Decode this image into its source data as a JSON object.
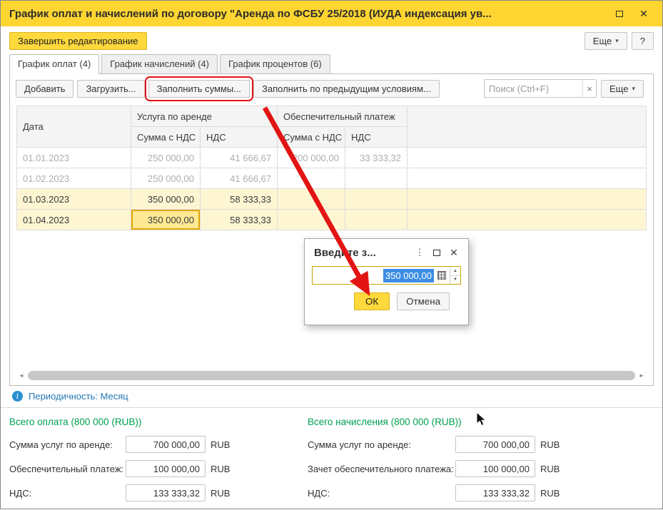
{
  "window": {
    "title": "График оплат и начислений по договору \"Аренда по ФСБУ 25/2018 (ИУДА индексация ув..."
  },
  "icons": {
    "dropdown": "▾",
    "close": "✕",
    "clear": "×",
    "dots": "⋮",
    "info": "i",
    "spin_up": "▲",
    "spin_down": "▼",
    "scroll_left": "◄",
    "scroll_right": "►"
  },
  "actions": {
    "finish": "Завершить редактирование",
    "more": "Еще",
    "help": "?"
  },
  "tabs": [
    {
      "label": "График оплат (4)"
    },
    {
      "label": "График начислений (4)"
    },
    {
      "label": "График процентов (6)"
    }
  ],
  "toolbar": {
    "add": "Добавить",
    "load": "Загрузить...",
    "fill_sums": "Заполнить суммы...",
    "fill_prev": "Заполнить по предыдущим условиям...",
    "search_placeholder": "Поиск (Ctrl+F)",
    "more": "Еще"
  },
  "table": {
    "col_date": "Дата",
    "col_service": "Услуга по аренде",
    "col_deposit": "Обеспечительный платеж",
    "col_sum_vat": "Сумма с НДС",
    "col_vat": "НДС",
    "rows": [
      {
        "date": "01.01.2023",
        "service_sum": "250 000,00",
        "service_vat": "41 666,67",
        "deposit_sum": "200 000,00",
        "deposit_vat": "33 333,32"
      },
      {
        "date": "01.02.2023",
        "service_sum": "250 000,00",
        "service_vat": "41 666,67",
        "deposit_sum": "",
        "deposit_vat": ""
      },
      {
        "date": "01.03.2023",
        "service_sum": "350 000,00",
        "service_vat": "58 333,33",
        "deposit_sum": "",
        "deposit_vat": ""
      },
      {
        "date": "01.04.2023",
        "service_sum": "350 000,00",
        "service_vat": "58 333,33",
        "deposit_sum": "",
        "deposit_vat": ""
      }
    ]
  },
  "dialog": {
    "title": "Введите з...",
    "value": "350 000,00",
    "ok": "ОК",
    "cancel": "Отмена"
  },
  "status": {
    "periodicity": "Периодичность: Месяц"
  },
  "totals": {
    "payment": {
      "title": "Всего оплата (800 000 (RUB))",
      "rows": [
        {
          "label": "Сумма услуг по аренде:",
          "value": "700 000,00",
          "currency": "RUB"
        },
        {
          "label": "Обеспечительный платеж:",
          "value": "100 000,00",
          "currency": "RUB"
        },
        {
          "label": "НДС:",
          "value": "133 333,32",
          "currency": "RUB"
        }
      ]
    },
    "accrual": {
      "title": "Всего начисления (800 000 (RUB))",
      "rows": [
        {
          "label": "Сумма услуг по аренде:",
          "value": "700 000,00",
          "currency": "RUB"
        },
        {
          "label": "Зачет обеспечительного платежа:",
          "value": "100 000,00",
          "currency": "RUB"
        },
        {
          "label": "НДС:",
          "value": "133 333,32",
          "currency": "RUB"
        }
      ]
    }
  }
}
